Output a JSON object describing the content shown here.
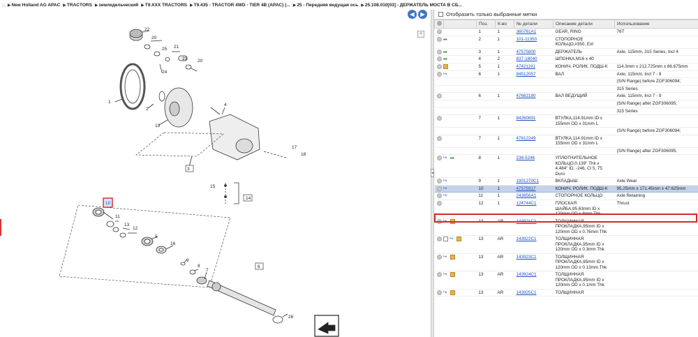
{
  "breadcrumb": [
    "New Holland AG APAC",
    "TRACTORS",
    "земледельческий",
    "T9.XXX TRACTORS",
    "T9.435 - TRACTOR 4WD - TIER 4B (APAC) (...",
    "25 - Передняя ведущая ось",
    "25.108.010[03] - ДЕРЖАТЕЛЬ МОСТА В СБ..."
  ],
  "nav": {
    "back": "◀",
    "forward": "▶"
  },
  "filter_label": "Отобразить только выбранные метки",
  "columns": [
    "",
    "",
    "Поз.",
    "К-во",
    "№ детали",
    "Описание детали",
    "Использование"
  ],
  "diagram": {
    "callouts": [
      "22",
      "20",
      "25",
      "21",
      "23",
      "24",
      "20",
      "1",
      "2",
      "19",
      "4",
      "17",
      "18",
      "3",
      "15",
      "14",
      "10",
      "11",
      "13",
      "12",
      "5",
      "16",
      "9",
      "8",
      "7",
      "6",
      "26"
    ],
    "selected_callout": "10"
  },
  "rows": [
    {
      "icons": [
        "info"
      ],
      "pos": "1",
      "qty": "1",
      "part": "360761A1",
      "desc": "GEAR, RING",
      "usage": "76T"
    },
    {
      "icons": [
        "info",
        "arrow"
      ],
      "pos": "2",
      "qty": "1",
      "part": "101-11350",
      "desc": "СТОПОРНОЕ КОЛЬЦО,#350, Ext",
      "usage": ""
    },
    {
      "icons": [
        "info",
        "arrow"
      ],
      "pos": "3",
      "qty": "1",
      "part": "47575800",
      "desc": "ДЕРЖАТЕЛЬ",
      "usage": "Axle, 115mm, 315 Series, Incl 4"
    },
    {
      "icons": [
        "info",
        "arrow"
      ],
      "pos": "4",
      "qty": "2",
      "part": "837-18040",
      "desc": "ШПОНКА,M16 x 40",
      "usage": ""
    },
    {
      "icons": [
        "info",
        "box"
      ],
      "pos": "5",
      "qty": "1",
      "part": "47421191",
      "desc": "КОНИЧ. РОЛИК. ПОДШ-К",
      "usage": "114.3mm x 212.725mm x 66.675mm"
    },
    {
      "icons": [
        "info",
        "link"
      ],
      "pos": "6",
      "qty": "1",
      "part": "84512057",
      "desc": "ВАЛ",
      "usage": "Axle, 115mm, Incl 7 - 9"
    },
    {
      "icons": [],
      "pos": "",
      "qty": "",
      "part": "",
      "desc": "",
      "usage": "(S/N Range) before ZGF306094;"
    },
    {
      "icons": [],
      "pos": "",
      "qty": "",
      "part": "",
      "desc": "",
      "usage": "315 Series"
    },
    {
      "icons": [
        "info"
      ],
      "pos": "6",
      "qty": "1",
      "part": "47682180",
      "desc": "ВАЛ ВЕДУЩИЙ",
      "usage": "Axle, 115mm, Incl 7 - 9"
    },
    {
      "icons": [],
      "pos": "",
      "qty": "",
      "part": "",
      "desc": "",
      "usage": "(S/N Range) after ZGF306095;"
    },
    {
      "icons": [],
      "pos": "",
      "qty": "",
      "part": "",
      "desc": "",
      "usage": "315 Series"
    },
    {
      "icons": [
        "info"
      ],
      "pos": "7",
      "qty": "1",
      "part": "84260691",
      "desc": "ВТУЛКА,114.91mm ID x 155mm OD x 31mm L",
      "usage": ""
    },
    {
      "icons": [],
      "pos": "",
      "qty": "",
      "part": "",
      "desc": "",
      "usage": "(S/N Range) before ZGF306094;"
    },
    {
      "icons": [
        "info"
      ],
      "pos": "7",
      "qty": "1",
      "part": "47812249",
      "desc": "ВТУЛКА,114.91mm ID x 155mm OD x 31mm L",
      "usage": ""
    },
    {
      "icons": [],
      "pos": "",
      "qty": "",
      "part": "",
      "desc": "",
      "usage": "(S/N Range) after ZGF306095;"
    },
    {
      "icons": [
        "info",
        "link",
        "arrow"
      ],
      "pos": "8",
      "qty": "1",
      "part": "238-5246",
      "desc": "УПЛОТНИТЕЛЬНОЕ КОЛЬЦО,0.139\" Thk x 4.484\" ID, -246, Cl 5, 75 Duro",
      "usage": ""
    },
    {
      "icons": [
        "info",
        "link"
      ],
      "pos": "9",
      "qty": "1",
      "part": "1901270C1",
      "desc": "ВКЛАДЫШ",
      "usage": "Axle Wear"
    },
    {
      "icons": [
        "info",
        "link"
      ],
      "pos": "10",
      "qty": "1",
      "part": "47575917",
      "desc": "КОНИЧ. РОЛИК. ПОДШ-К",
      "usage": "95.25mm x 171.45mm x 47.625mm",
      "selected": true
    },
    {
      "icons": [
        "info",
        "link"
      ],
      "pos": "11",
      "qty": "1",
      "part": "243856A1",
      "desc": "СТОПОРНОЕ КОЛЬЦО",
      "usage": "Axle Retaining"
    },
    {
      "icons": [
        "info"
      ],
      "pos": "12",
      "qty": "1",
      "part": "124744C1",
      "desc": "ПЛОСКАЯ ШАЙБА,95.63mm ID x 120mm OD x 8mm Thk",
      "usage": "Thrust"
    },
    {
      "icons": [
        "info",
        "link",
        "box"
      ],
      "pos": "13",
      "qty": "AR",
      "part": "143921C1",
      "desc": "ТОЛЩИННАЯ ПРОКЛАДКА,95mm ID x 120mm OD x 0.76mm Thk",
      "usage": ""
    },
    {
      "icons": [
        "info",
        "note",
        "link",
        "box"
      ],
      "pos": "13",
      "qty": "AR",
      "part": "143922C1",
      "desc": "ТОЛЩИННАЯ ПРОКЛАДКА,95mm ID x 120mm OD x 0.3mm Thk",
      "usage": ""
    },
    {
      "icons": [
        "info",
        "link",
        "box"
      ],
      "pos": "13",
      "qty": "AR",
      "part": "143923C1",
      "desc": "ТОЛЩИННАЯ ПРОКЛАДКА,95mm ID x 120mm OD x 0.13mm Thk",
      "usage": ""
    },
    {
      "icons": [
        "info",
        "link",
        "box"
      ],
      "pos": "13",
      "qty": "AR",
      "part": "143924C1",
      "desc": "ТОЛЩИННАЯ ПРОКЛАДКА,95mm ID x 120mm OD x 0.1mm Thk",
      "usage": ""
    },
    {
      "icons": [
        "info",
        "link",
        "box"
      ],
      "pos": "13",
      "qty": "AR",
      "part": "143925C1",
      "desc": "ТОЛЩИННАЯ",
      "usage": ""
    }
  ]
}
